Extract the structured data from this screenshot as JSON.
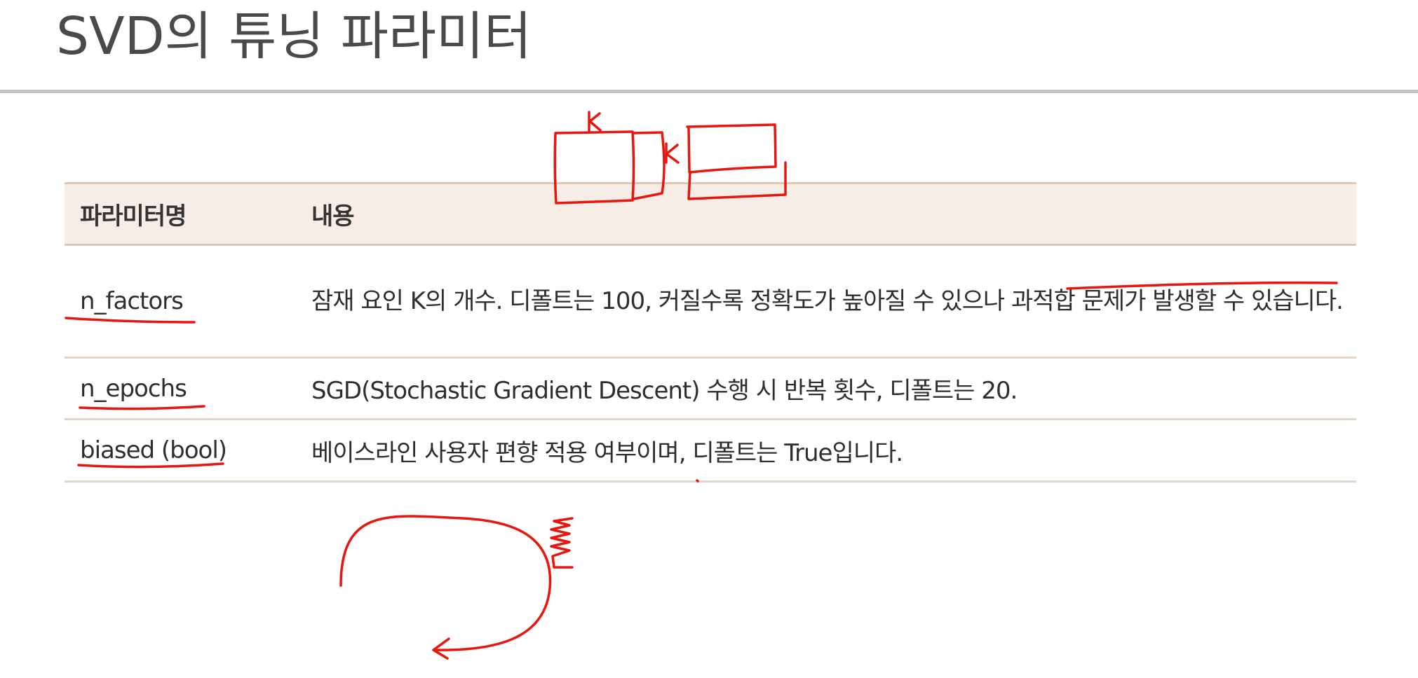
{
  "slide": {
    "title": "SVD의 튜닝 파라미터"
  },
  "table": {
    "headers": {
      "name": "파라미터명",
      "description": "내용"
    },
    "rows": [
      {
        "name": "n_factors",
        "description": "잠재 요인 K의 개수. 디폴트는 100, 커질수록 정확도가 높아질 수 있으나 과적합 문제가 발생할 수 있습니다."
      },
      {
        "name": "n_epochs",
        "description": "SGD(Stochastic Gradient Descent) 수행 시 반복 횟수, 디폴트는 20."
      },
      {
        "name": "biased (bool)",
        "description": "베이스라인 사용자 편향 적용 여부이며, 디폴트는 True입니다."
      }
    ]
  },
  "annotations": {
    "label_k_top": "K",
    "label_k_side": "K",
    "ink_color": "#e8160e"
  }
}
